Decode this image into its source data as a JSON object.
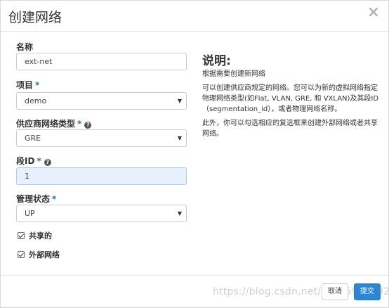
{
  "modal": {
    "title": "创建网络",
    "close": "×"
  },
  "form": {
    "name": {
      "label": "名称",
      "value": "ext-net"
    },
    "project": {
      "label": "项目",
      "required": "*",
      "value": "demo"
    },
    "provider_type": {
      "label": "供应商网络类型",
      "required": "*",
      "help": "?",
      "value": "GRE"
    },
    "segment_id": {
      "label": "段ID",
      "required": "*",
      "help": "?",
      "value": "1"
    },
    "admin_state": {
      "label": "管理状态",
      "required": "*",
      "value": "UP"
    },
    "shared": {
      "label": "共享的",
      "checked": true
    },
    "external": {
      "label": "外部网络",
      "checked": true
    },
    "caret": "▼"
  },
  "description": {
    "title": "说明:",
    "p1": "根据需要创建新网络",
    "p2": "可以创建供应商规定的网络。您可以为新的虚拟网络指定物理网络类型(如Flat, VLAN, GRE, 和 VXLAN)及其段ID（segmentation_id），或者物理网络名称。",
    "p3": "此外，你可以勾选相应的复选框来创建外部网络或者共享网络。"
  },
  "footer": {
    "cancel": "取消",
    "submit": "提交"
  },
  "watermark": "https://blog.csdn.net/qq_45932592",
  "colors": {
    "accent": "#1a73c6",
    "submit_bg": "#2f86d0",
    "focused_input_bg": "#e8f0fe"
  }
}
